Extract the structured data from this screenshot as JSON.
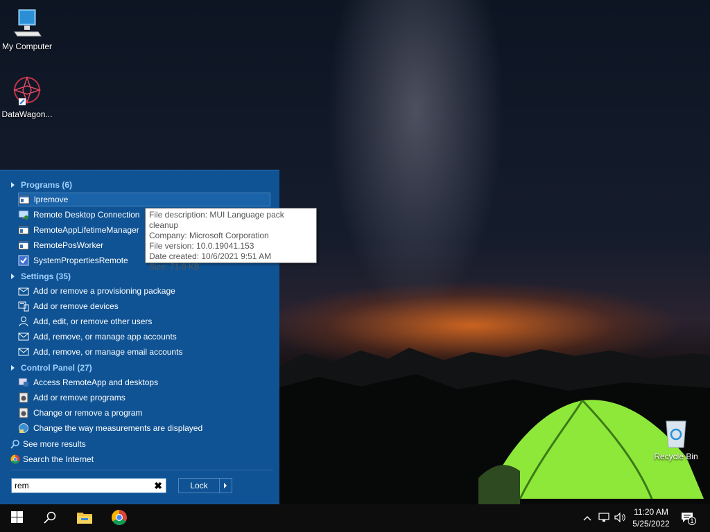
{
  "desktop": {
    "icons": [
      {
        "label": "My Computer"
      },
      {
        "label": "DataWagon..."
      },
      {
        "label": "Recycle Bin"
      }
    ]
  },
  "start_menu": {
    "groups": [
      {
        "label": "Programs (6)"
      },
      {
        "label": "Settings (35)"
      },
      {
        "label": "Control Panel (27)"
      }
    ],
    "programs": [
      {
        "label": "lpremove",
        "icon": "program-window-icon"
      },
      {
        "label": "Remote Desktop Connection",
        "icon": "remote-desktop-icon"
      },
      {
        "label": "RemoteAppLifetimeManager",
        "icon": "program-window-icon"
      },
      {
        "label": "RemotePosWorker",
        "icon": "program-window-icon"
      },
      {
        "label": "SystemPropertiesRemote",
        "icon": "system-properties-icon"
      }
    ],
    "settings": [
      {
        "label": "Add or remove a provisioning package",
        "icon": "package-icon"
      },
      {
        "label": "Add or remove devices",
        "icon": "devices-icon"
      },
      {
        "label": "Add, edit, or remove other users",
        "icon": "user-icon"
      },
      {
        "label": "Add, remove, or manage app accounts",
        "icon": "mail-icon"
      },
      {
        "label": "Add, remove, or manage email accounts",
        "icon": "mail-icon"
      }
    ],
    "control_panel": [
      {
        "label": "Access RemoteApp and desktops",
        "icon": "remoteapp-icon"
      },
      {
        "label": "Add or remove programs",
        "icon": "programs-icon"
      },
      {
        "label": "Change or remove a program",
        "icon": "programs-icon"
      },
      {
        "label": "Change the way measurements are displayed",
        "icon": "region-icon"
      }
    ],
    "see_more": "See more results",
    "search_internet": "Search the Internet",
    "search_value": "rem",
    "lock_label": "Lock"
  },
  "tooltip": {
    "lines": [
      "File description: MUI Language pack cleanup",
      "Company: Microsoft Corporation",
      "File version: 10.0.19041.153",
      "Date created: 10/6/2021 9:51 AM",
      "Size: 71.0 KB"
    ]
  },
  "taskbar": {
    "time": "11:20 AM",
    "date": "5/25/2022",
    "notification_count": "1"
  },
  "colors": {
    "menu_bg": "#0f5394",
    "group_text": "#9fd0ff",
    "selected_bg": "#1b63a8",
    "taskbar_bg": "#0d0d0d"
  }
}
